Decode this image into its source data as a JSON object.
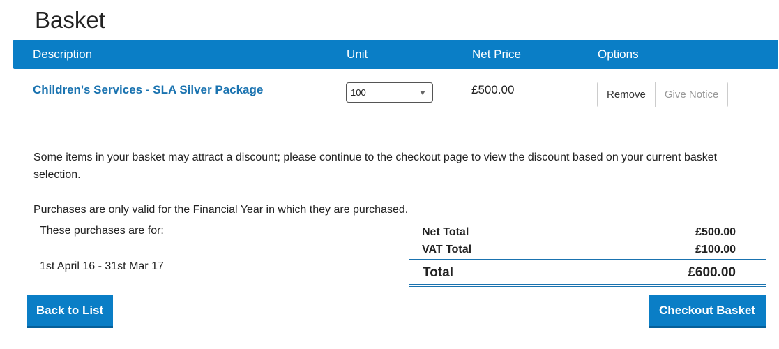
{
  "page": {
    "title": "Basket"
  },
  "table": {
    "headers": {
      "description": "Description",
      "unit": "Unit",
      "net_price": "Net Price",
      "options": "Options"
    },
    "rows": [
      {
        "description": "Children's Services - SLA Silver Package",
        "unit_value": "100",
        "net_price": "£500.00",
        "remove_label": "Remove",
        "give_notice_label": "Give Notice"
      }
    ]
  },
  "notes": {
    "discount": "Some items in your basket may attract a discount; please continue to the checkout page to view the discount based on your current basket selection.",
    "financial_year": "Purchases are only valid for the Financial Year in which they are purchased.",
    "purchases_for_label": "These purchases are for:",
    "date_range": "1st April 16 - 31st Mar 17"
  },
  "totals": {
    "net_label": "Net Total",
    "net_value": "£500.00",
    "vat_label": "VAT Total",
    "vat_value": "£100.00",
    "total_label": "Total",
    "total_value": "£600.00"
  },
  "actions": {
    "back_label": "Back to List",
    "checkout_label": "Checkout Basket"
  },
  "colors": {
    "accent": "#0a7ec6",
    "link": "#1a73b0"
  }
}
